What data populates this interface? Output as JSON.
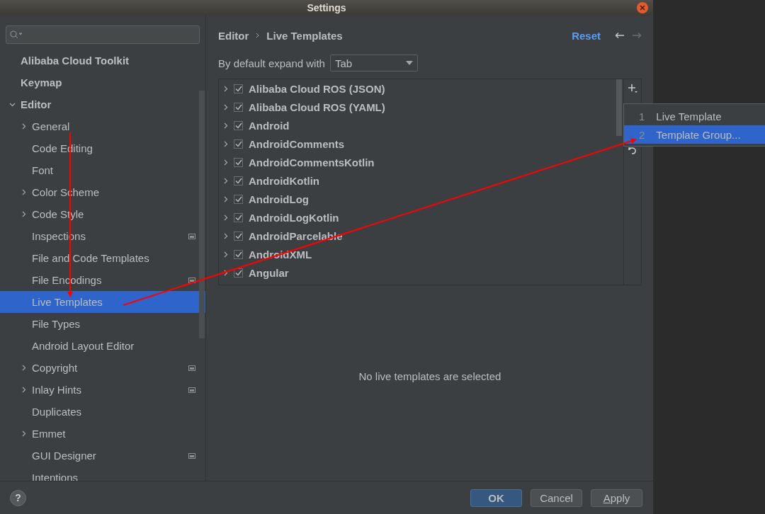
{
  "window": {
    "title": "Settings"
  },
  "sidebar": {
    "items": [
      {
        "label": "Alibaba Cloud Toolkit",
        "kind": "top",
        "selected": false
      },
      {
        "label": "Keymap",
        "kind": "top",
        "selected": false
      },
      {
        "label": "Editor",
        "kind": "top",
        "expanded": true,
        "selected": false,
        "children": [
          {
            "label": "General",
            "expandable": true,
            "selected": false
          },
          {
            "label": "Code Editing",
            "selected": false
          },
          {
            "label": "Font",
            "selected": false
          },
          {
            "label": "Color Scheme",
            "expandable": true,
            "selected": false
          },
          {
            "label": "Code Style",
            "expandable": true,
            "selected": false
          },
          {
            "label": "Inspections",
            "project": true,
            "selected": false
          },
          {
            "label": "File and Code Templates",
            "selected": false
          },
          {
            "label": "File Encodings",
            "project": true,
            "selected": false
          },
          {
            "label": "Live Templates",
            "selected": true
          },
          {
            "label": "File Types",
            "selected": false
          },
          {
            "label": "Android Layout Editor",
            "selected": false
          },
          {
            "label": "Copyright",
            "expandable": true,
            "project": true,
            "selected": false
          },
          {
            "label": "Inlay Hints",
            "expandable": true,
            "project": true,
            "selected": false
          },
          {
            "label": "Duplicates",
            "selected": false
          },
          {
            "label": "Emmet",
            "expandable": true,
            "selected": false
          },
          {
            "label": "GUI Designer",
            "project": true,
            "selected": false
          },
          {
            "label": "Intentions",
            "selected": false
          }
        ]
      }
    ]
  },
  "breadcrumb": [
    "Editor",
    "Live Templates"
  ],
  "reset": "Reset",
  "expand_with": {
    "label": "By default expand with",
    "value": "Tab"
  },
  "templates": [
    {
      "label": "Alibaba Cloud ROS (JSON)",
      "checked": true
    },
    {
      "label": "Alibaba Cloud ROS (YAML)",
      "checked": true
    },
    {
      "label": "Android",
      "checked": true
    },
    {
      "label": "AndroidComments",
      "checked": true
    },
    {
      "label": "AndroidCommentsKotlin",
      "checked": true
    },
    {
      "label": "AndroidKotlin",
      "checked": true
    },
    {
      "label": "AndroidLog",
      "checked": true
    },
    {
      "label": "AndroidLogKotlin",
      "checked": true
    },
    {
      "label": "AndroidParcelable",
      "checked": true
    },
    {
      "label": "AndroidXML",
      "checked": true
    },
    {
      "label": "Angular",
      "checked": true
    }
  ],
  "empty_message": "No live templates are selected",
  "add_menu": [
    {
      "number": "1",
      "label": "Live Template",
      "selected": false
    },
    {
      "number": "2",
      "label": "Template Group...",
      "selected": true
    }
  ],
  "buttons": [
    {
      "label": "OK",
      "kind": "default",
      "mnemonic": false
    },
    {
      "label": "Cancel",
      "kind": "normal",
      "mnemonic": false
    },
    {
      "label": "Apply",
      "kind": "normal",
      "mnemonic": true
    }
  ],
  "help": "?"
}
